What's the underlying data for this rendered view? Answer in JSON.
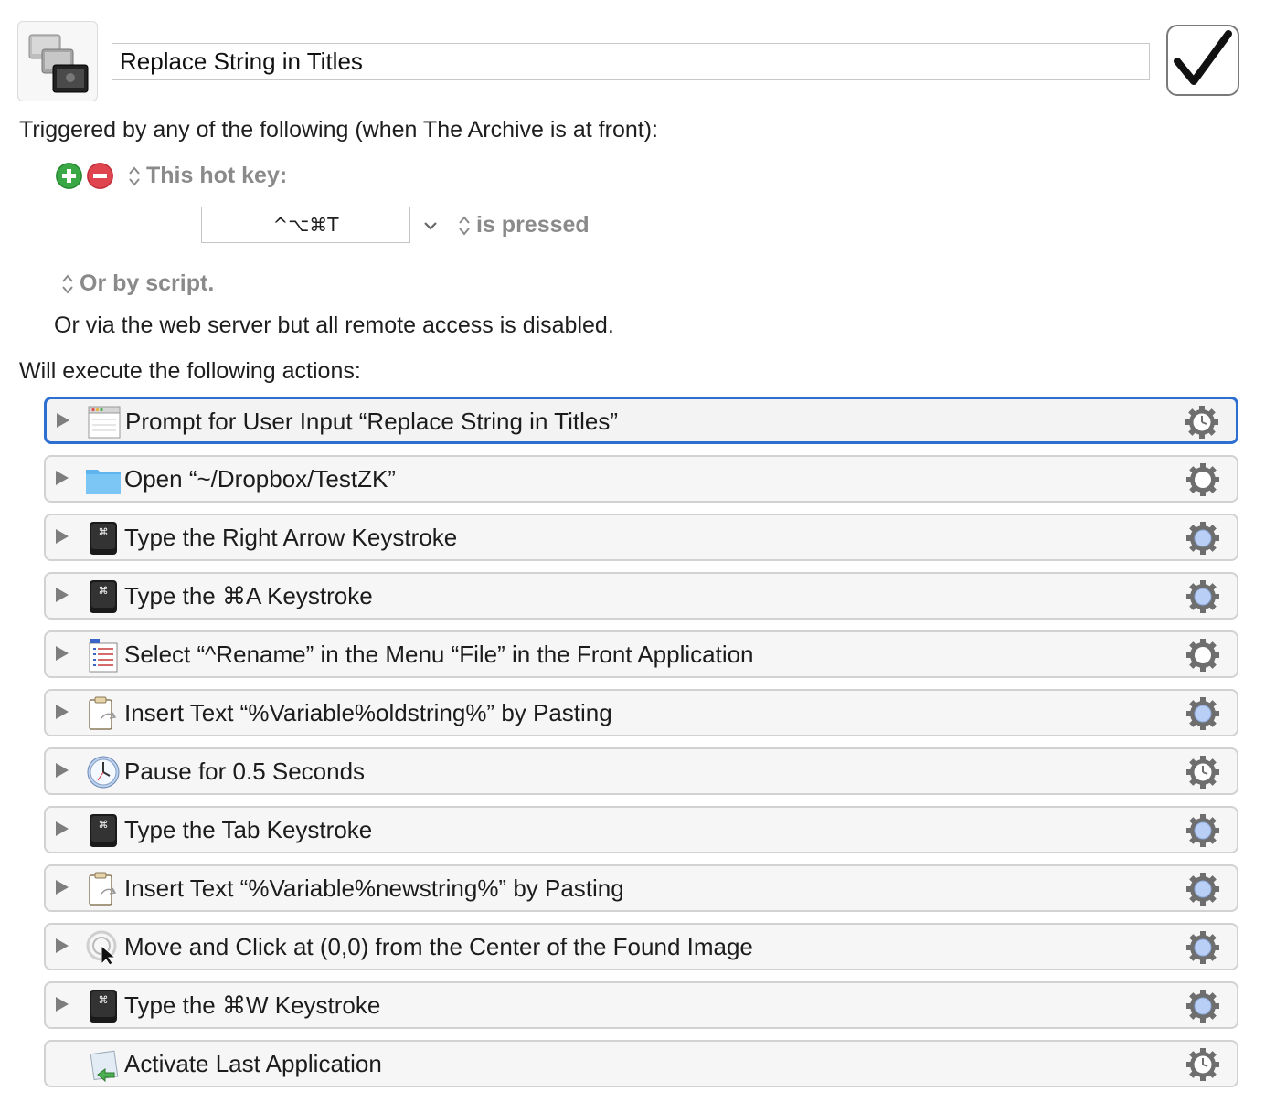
{
  "macro": {
    "name": "Replace String in Titles",
    "icon": "macro-group-icon",
    "enabled": true
  },
  "triggers": {
    "heading": "Triggered by any of the following (when The Archive is at front):",
    "trigger_type": "This hot key:",
    "hotkey": "^⌥⌘T",
    "hotkey_condition": "is pressed",
    "or_script": "Or by script.",
    "web_server": "Or via the web server but all remote access is disabled."
  },
  "actions_heading": "Will execute the following actions:",
  "actions": [
    {
      "label": "Prompt for User Input “Replace String in Titles”",
      "icon": "window-icon",
      "gear": "gear-clock"
    },
    {
      "label": "Open “~/Dropbox/TestZK”",
      "icon": "folder-icon",
      "gear": "gear-plain"
    },
    {
      "label": "Type the Right Arrow Keystroke",
      "icon": "command-key-icon",
      "gear": "gear-blue"
    },
    {
      "label": "Type the ⌘A Keystroke",
      "icon": "command-key-icon",
      "gear": "gear-blue"
    },
    {
      "label": "Select “^Rename” in the Menu “File” in the Front Application",
      "icon": "menu-list-icon",
      "gear": "gear-plain"
    },
    {
      "label": "Insert Text “%Variable%oldstring%” by Pasting",
      "icon": "clipboard-icon",
      "gear": "gear-blue"
    },
    {
      "label": "Pause for 0.5 Seconds",
      "icon": "clock-icon",
      "gear": "gear-clock"
    },
    {
      "label": "Type the Tab Keystroke",
      "icon": "command-key-icon",
      "gear": "gear-blue"
    },
    {
      "label": "Insert Text “%Variable%newstring%” by Pasting",
      "icon": "clipboard-icon",
      "gear": "gear-blue"
    },
    {
      "label": "Move and Click at (0,0) from the Center of the Found Image",
      "icon": "click-target-icon",
      "gear": "gear-blue"
    },
    {
      "label": "Type the ⌘W Keystroke",
      "icon": "command-key-icon",
      "gear": "gear-blue"
    },
    {
      "label": "Activate Last Application",
      "icon": "activate-app-icon",
      "gear": "gear-clock"
    }
  ],
  "colors": {
    "selected_border": "#2d6fd0",
    "add_button": "#3aa845",
    "remove_button": "#e0444f",
    "gear_blue": "#b9cff5"
  }
}
